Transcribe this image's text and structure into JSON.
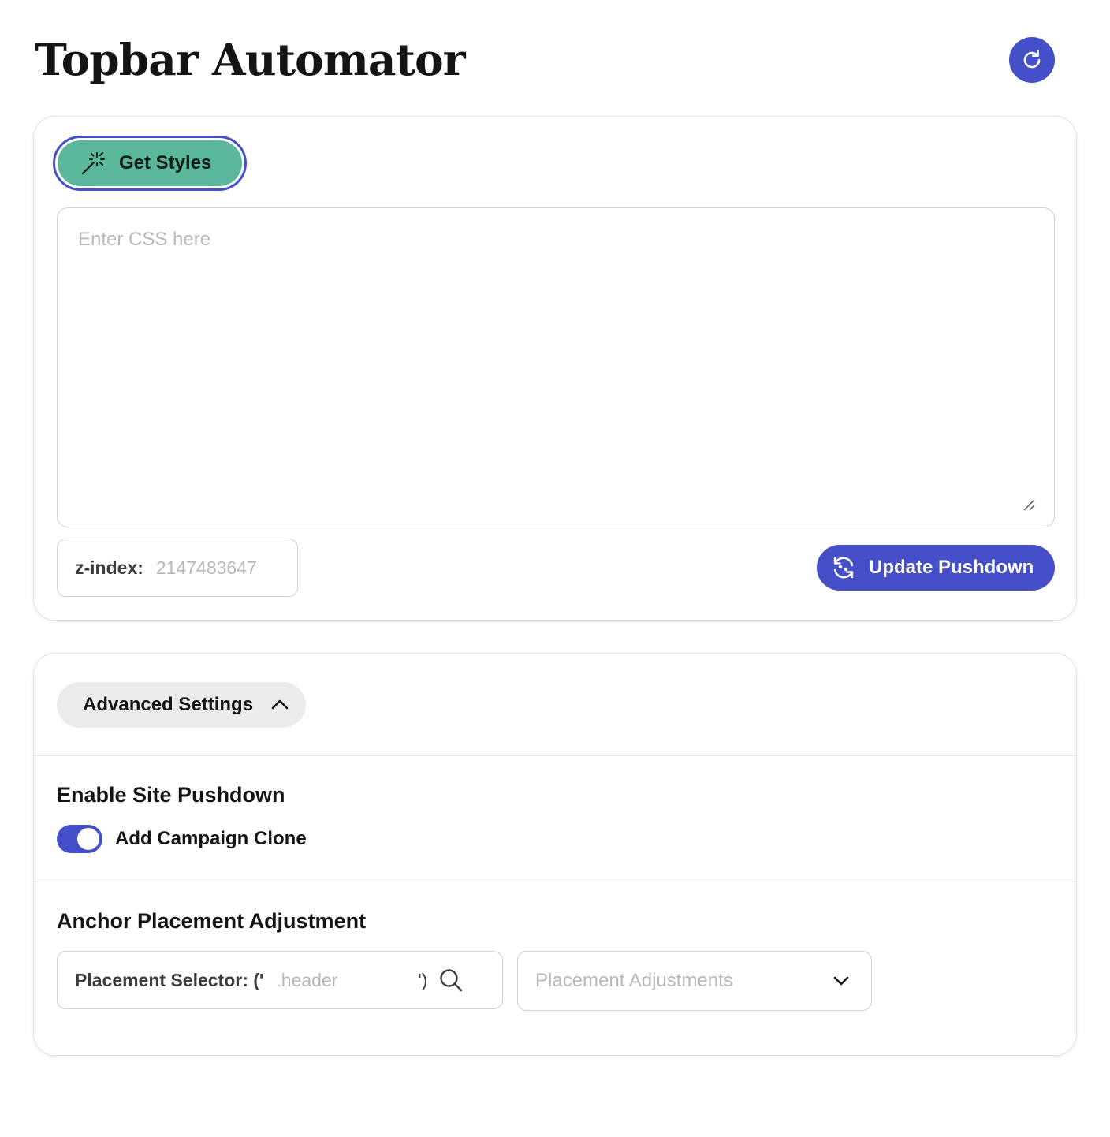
{
  "header": {
    "title": "Topbar Automator",
    "refresh_icon": "refresh-icon"
  },
  "styles_panel": {
    "get_styles_label": "Get Styles",
    "get_styles_icon": "magic-wand-icon",
    "css_placeholder": "Enter CSS here",
    "css_value": "",
    "zindex_label": "z-index:",
    "zindex_placeholder": "2147483647",
    "update_label": "Update Pushdown",
    "update_icon": "sync-icon"
  },
  "advanced": {
    "toggle_label": "Advanced Settings",
    "expanded": true,
    "pushdown_heading": "Enable Site Pushdown",
    "clone_label": "Add Campaign Clone",
    "clone_enabled": true,
    "anchor_heading": "Anchor Placement Adjustment",
    "selector_prefix": "Placement Selector: ('",
    "selector_placeholder": ".header",
    "selector_suffix": "')",
    "adjustments_placeholder": "Placement Adjustments"
  },
  "colors": {
    "accent": "#4550c8",
    "get_styles_bg": "#5bb79b",
    "placeholder": "#b6b8be"
  }
}
